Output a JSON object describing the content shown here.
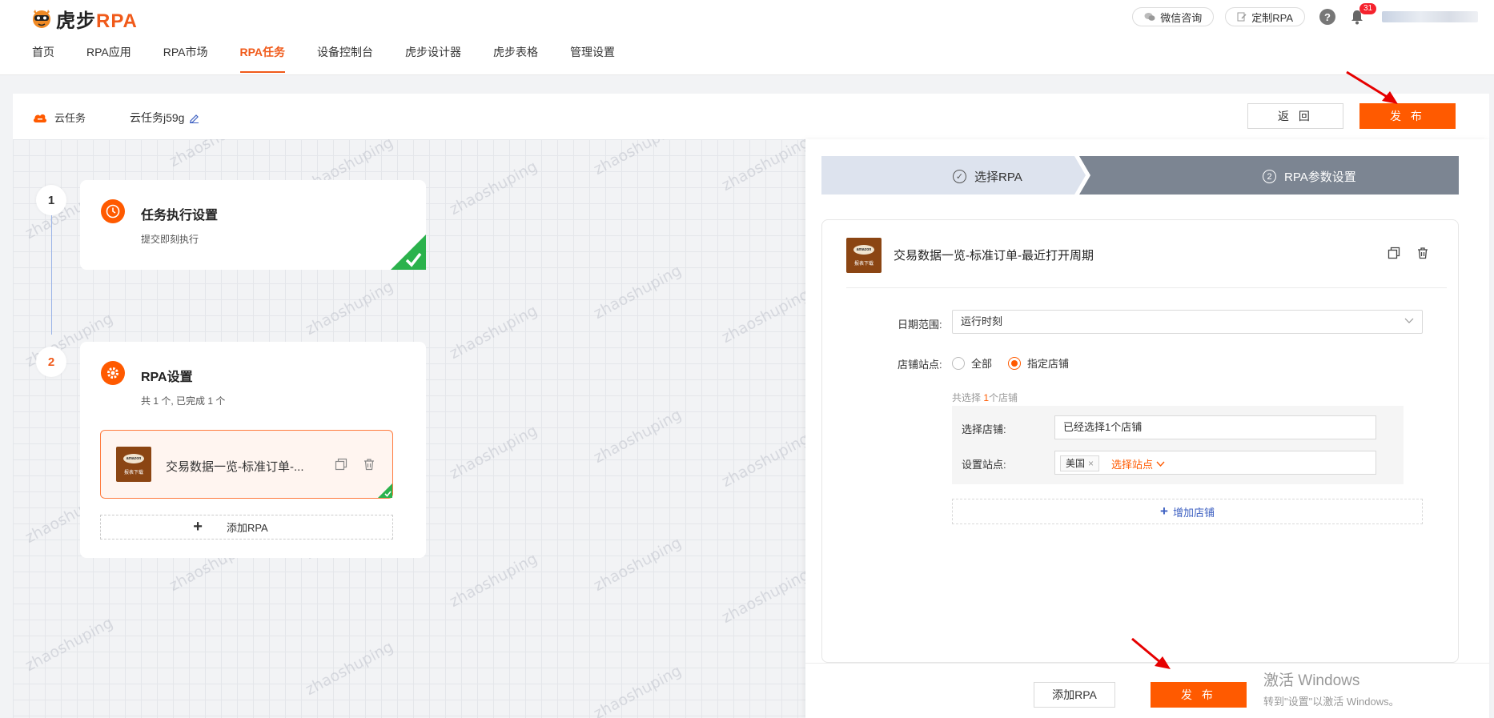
{
  "brand": {
    "logo_main": "虎步",
    "logo_rpa": "RPA",
    "accent": "#ff5a00"
  },
  "header": {
    "wechat_label": "微信咨询",
    "custom_rpa_label": "定制RPA",
    "help_icon": "?",
    "notification_count": "31",
    "nav": [
      {
        "label": "首页"
      },
      {
        "label": "RPA应用"
      },
      {
        "label": "RPA市场"
      },
      {
        "label": "RPA任务"
      },
      {
        "label": "设备控制台"
      },
      {
        "label": "虎步设计器"
      },
      {
        "label": "虎步表格"
      },
      {
        "label": "管理设置"
      }
    ]
  },
  "taskbar": {
    "task_type": "云任务",
    "task_name": "云任务j59g",
    "back_label": "返 回",
    "publish_label": "发 布"
  },
  "flow": {
    "step1": {
      "num": "1",
      "title": "任务执行设置",
      "subtitle": "提交即刻执行"
    },
    "step2": {
      "num": "2",
      "title": "RPA设置",
      "subtitle": "共 1 个, 已完成 1 个",
      "item_name": "交易数据一览-标准订单-...",
      "add_label": "添加RPA"
    },
    "watermark": "zhaoshuping"
  },
  "thumb": {
    "logo": "amazon",
    "label": "报表下载"
  },
  "panel": {
    "stepper": {
      "step1_num": "✓",
      "step1_label": "选择RPA",
      "step2_num": "2",
      "step2_label": "RPA参数设置"
    },
    "rpa_title": "交易数据一览-标准订单-最近打开周期",
    "date_range_label": "日期范围:",
    "date_range_value": "运行时刻",
    "shop_site_label": "店铺站点:",
    "radio_all": "全部",
    "radio_specific": "指定店铺",
    "shop_count_prefix": "共选择 ",
    "shop_count_n": "1",
    "shop_count_suffix": "个店铺",
    "select_shop_label": "选择店铺:",
    "select_shop_value": "已经选择1个店铺",
    "set_site_label": "设置站点:",
    "site_tag": "美国",
    "select_site_label": "选择站点",
    "add_shop_label": "增加店铺",
    "footer": {
      "add_rpa_label": "添加RPA",
      "publish_label": "发 布"
    }
  },
  "windows_activation": {
    "line1": "激活 Windows",
    "line2": "转到\"设置\"以激活 Windows。"
  }
}
